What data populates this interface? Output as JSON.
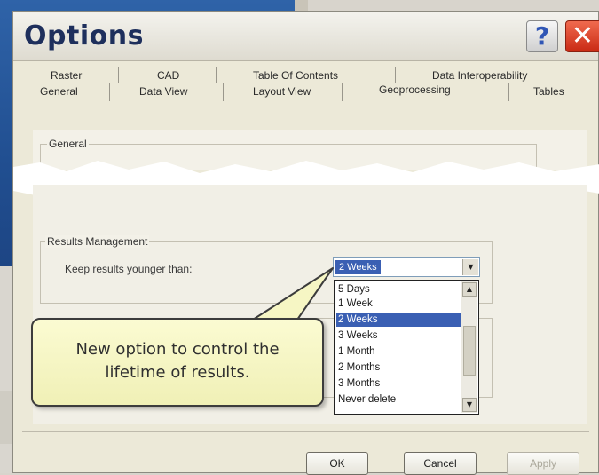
{
  "dialog": {
    "title": "Options",
    "help_label": "?",
    "close_label": "✕"
  },
  "tabs": {
    "row1": [
      "Raster",
      "CAD",
      "Table Of Contents",
      "Data Interoperability"
    ],
    "row2": [
      "General",
      "Data View",
      "Layout View",
      "Geoprocessing",
      "Tables"
    ],
    "active": "Geoprocessing"
  },
  "general_group": {
    "label": "General"
  },
  "results_management": {
    "label": "Results Management",
    "keep_label": "Keep results younger than:",
    "selected": "2 Weeks",
    "options": [
      "5 Days",
      "1 Week",
      "2 Weeks",
      "3 Weeks",
      "1 Month",
      "2 Months",
      "3 Months",
      "Never delete"
    ]
  },
  "callout": {
    "line1": "New option to control the",
    "line2": "lifetime of results."
  },
  "footer": {
    "ok": "OK",
    "cancel": "Cancel",
    "apply": "Apply"
  },
  "colors": {
    "accent_selection": "#3a5fb3",
    "title_text": "#1e2f5c",
    "close_red": "#d6391f",
    "callout_yellow": "#f6f6c4"
  }
}
